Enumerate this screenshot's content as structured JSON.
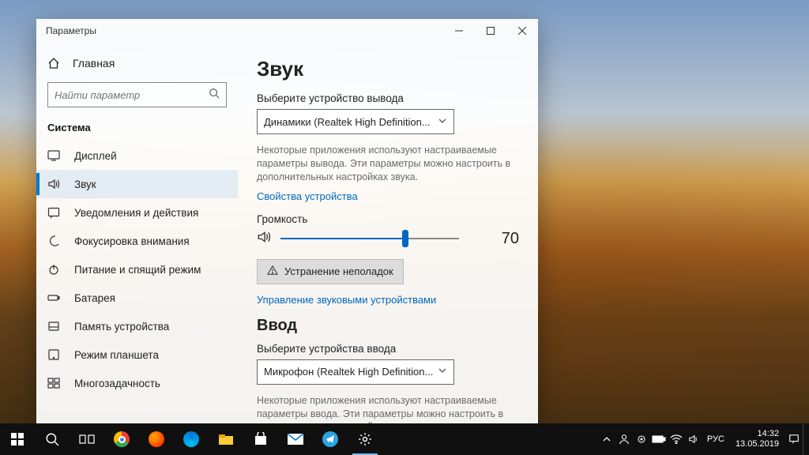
{
  "window": {
    "title": "Параметры"
  },
  "sidebar": {
    "home": "Главная",
    "search_placeholder": "Найти параметр",
    "section": "Система",
    "items": [
      {
        "label": "Дисплей"
      },
      {
        "label": "Звук"
      },
      {
        "label": "Уведомления и действия"
      },
      {
        "label": "Фокусировка внимания"
      },
      {
        "label": "Питание и спящий режим"
      },
      {
        "label": "Батарея"
      },
      {
        "label": "Память устройства"
      },
      {
        "label": "Режим планшета"
      },
      {
        "label": "Многозадачность"
      }
    ]
  },
  "content": {
    "title": "Звук",
    "output_label": "Выберите устройство вывода",
    "output_device": "Динамики (Realtek High Definition...",
    "output_desc": "Некоторые приложения используют настраиваемые параметры вывода. Эти параметры можно настроить в дополнительных настройках звука.",
    "device_props": "Свойства устройства",
    "volume_label": "Громкость",
    "volume_value": "70",
    "troubleshoot": "Устранение неполадок",
    "manage_devices": "Управление звуковыми устройствами",
    "input_title": "Ввод",
    "input_label": "Выберите устройства ввода",
    "input_device": "Микрофон (Realtek High Definition...",
    "input_desc": "Некоторые приложения используют настраиваемые параметры ввода. Эти параметры можно настроить в дополнительных настройках звука."
  },
  "taskbar": {
    "lang": "РУС",
    "time": "14:32",
    "date": "13.05.2019"
  }
}
